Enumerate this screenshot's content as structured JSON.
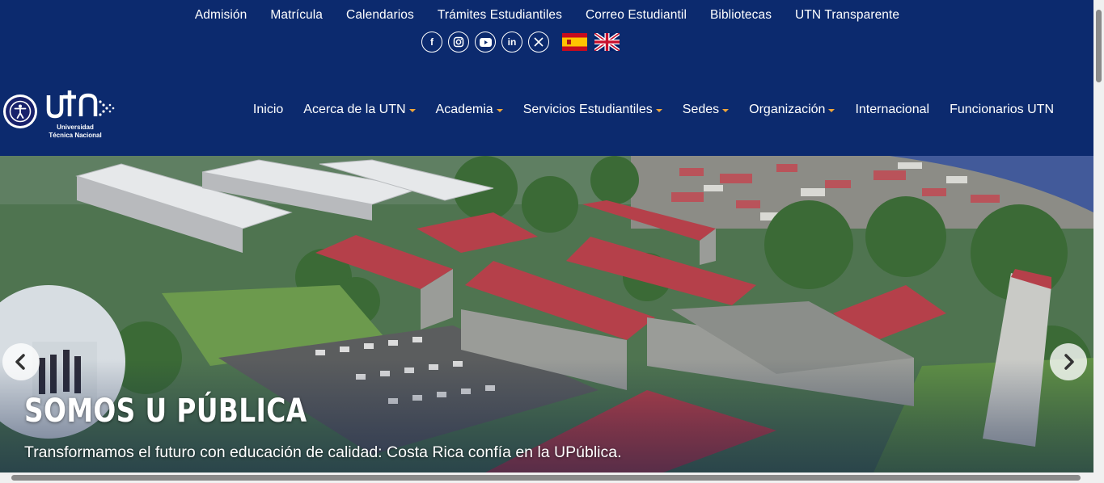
{
  "topbar": {
    "links": [
      "Admisión",
      "Matrícula",
      "Calendarios",
      "Trámites Estudiantiles",
      "Correo Estudiantil",
      "Bibliotecas",
      "UTN Transparente"
    ]
  },
  "socials": {
    "icons": [
      "facebook-icon",
      "instagram-icon",
      "youtube-icon",
      "linkedin-icon",
      "x-icon"
    ],
    "glyphs": [
      "f",
      "◎",
      "▶",
      "in",
      "𝕏"
    ],
    "flags": [
      "spain-flag",
      "uk-flag"
    ]
  },
  "logo": {
    "mark": "UTN",
    "line1": "Universidad",
    "line2": "Técnica Nacional"
  },
  "nav": {
    "items": [
      {
        "label": "Inicio",
        "dropdown": false
      },
      {
        "label": "Acerca de la UTN",
        "dropdown": true
      },
      {
        "label": "Academia",
        "dropdown": true
      },
      {
        "label": "Servicios Estudiantiles",
        "dropdown": true
      },
      {
        "label": "Sedes",
        "dropdown": true
      },
      {
        "label": "Organización",
        "dropdown": true
      },
      {
        "label": "Internacional",
        "dropdown": false
      },
      {
        "label": "Funcionarios UTN",
        "dropdown": false
      }
    ]
  },
  "hero": {
    "title": "SOMOS U PÚBLICA",
    "subtitle": "Transformamos el futuro con educación de calidad: Costa Rica confía en la UPública.",
    "prev_icon": "chevron-left-icon",
    "next_icon": "chevron-right-icon"
  },
  "colors": {
    "header_bg": "#0c2a6e",
    "accent_caret": "#f0a63a",
    "roof_red": "#b5404a"
  }
}
